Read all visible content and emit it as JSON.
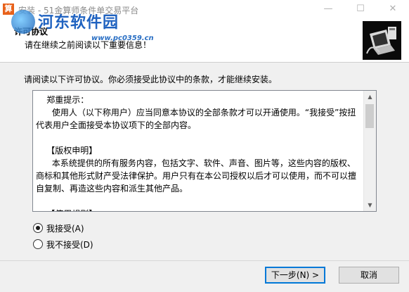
{
  "window": {
    "app_icon_glyph": "算",
    "title": "安装 - 51金算师条件单交易平台",
    "minimize_glyph": "—",
    "maximize_glyph": "☐",
    "close_glyph": "✕"
  },
  "watermark": {
    "name": "河东软件园",
    "url": "www.pc0359.cn"
  },
  "header": {
    "title": "许可协议",
    "subtitle": "请在继续之前阅读以下重要信息！"
  },
  "instruction": "请阅读以下许可协议。你必须接受此协议中的条款，才能继续安装。",
  "license_text": "    郑重提示：\n      使用人（以下称用户）应当同意本协议的全部条款才可以开通使用。“我接受”按扭代表用户全面接受本协议项下的全部内容。\n\n    【版权申明】\n      本系统提供的所有服务内容，包括文字、软件、声音、图片等，这些内容的版权、商标和其他形式财产受法律保护。用户只有在本公司授权以后才可以使用，而不可以擅自复制、再造这些内容和派生其他产品。\n\n    【使用规则】\n      用户在使用本系统时必须遵守以下规则：",
  "options": {
    "accept": {
      "label": "我接受(A)",
      "selected": true
    },
    "decline": {
      "label": "我不接受(D)",
      "selected": false
    }
  },
  "buttons": {
    "next": "下一步(N) >",
    "cancel": "取消"
  }
}
